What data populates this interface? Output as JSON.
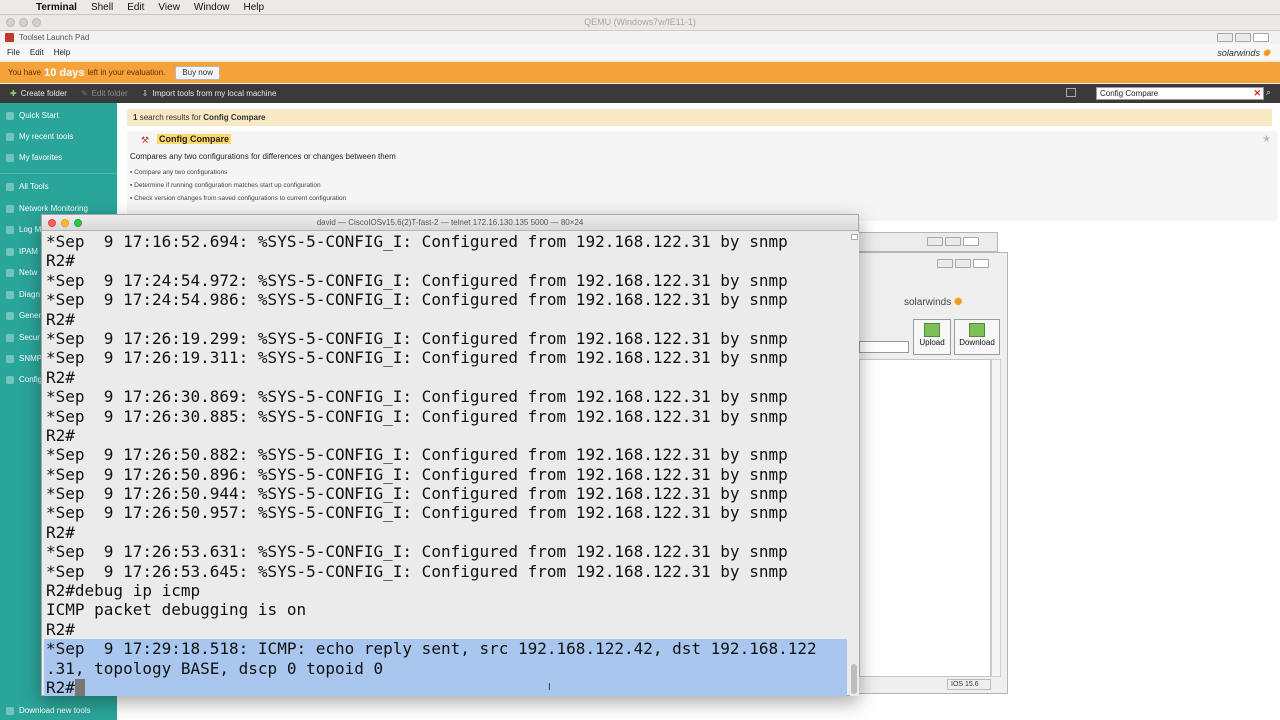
{
  "mac_menu": {
    "apple": "",
    "items": [
      "Terminal",
      "Shell",
      "Edit",
      "View",
      "Window",
      "Help"
    ]
  },
  "qemu": {
    "title": "QEMU (Windows7w/IE11-1)"
  },
  "app": {
    "title": "Toolset Launch Pad",
    "menus": [
      "File",
      "Edit",
      "Help"
    ],
    "brand": "solarwinds",
    "eval_prefix": "You have",
    "eval_days": "10 days",
    "eval_suffix": "left in your evaluation.",
    "buy_label": "Buy now",
    "toolbar": {
      "create_folder": "Create folder",
      "edit_folder": "Edit folder",
      "import_tools": "Import tools from my local machine"
    },
    "search_value": "Config Compare",
    "sidebar": [
      "Quick Start",
      "My recent tools",
      "My favorites",
      "All Tools",
      "Network Monitoring",
      "Log M",
      "IPAM",
      "Netw",
      "Diagn",
      "Gener",
      "Secur",
      "SNMP",
      "Config"
    ],
    "download_tools": "Download new tools",
    "results": {
      "count": "1",
      "text": "search results for",
      "query": "Config Compare"
    },
    "card": {
      "title": "Config Compare",
      "description": "Compares any two configurations for differences or changes between them",
      "features": [
        "Compare any two configurations",
        "Determine if running configuration matches start up configuration",
        "Check version changes from saved configurations to current configuration"
      ]
    },
    "child_window": {
      "upload": "Upload",
      "download": "Download",
      "status": "IOS  15.6"
    }
  },
  "terminal": {
    "title": "david — CiscoIOSv15.6(2)T-fast-2 — telnet 172.16.130.135 5000 — 80×24",
    "lines": [
      "*Sep  9 17:16:52.694: %SYS-5-CONFIG_I: Configured from 192.168.122.31 by snmp",
      "R2#",
      "*Sep  9 17:24:54.972: %SYS-5-CONFIG_I: Configured from 192.168.122.31 by snmp",
      "*Sep  9 17:24:54.986: %SYS-5-CONFIG_I: Configured from 192.168.122.31 by snmp",
      "R2#",
      "*Sep  9 17:26:19.299: %SYS-5-CONFIG_I: Configured from 192.168.122.31 by snmp",
      "*Sep  9 17:26:19.311: %SYS-5-CONFIG_I: Configured from 192.168.122.31 by snmp",
      "R2#",
      "*Sep  9 17:26:30.869: %SYS-5-CONFIG_I: Configured from 192.168.122.31 by snmp",
      "*Sep  9 17:26:30.885: %SYS-5-CONFIG_I: Configured from 192.168.122.31 by snmp",
      "R2#",
      "*Sep  9 17:26:50.882: %SYS-5-CONFIG_I: Configured from 192.168.122.31 by snmp",
      "*Sep  9 17:26:50.896: %SYS-5-CONFIG_I: Configured from 192.168.122.31 by snmp",
      "*Sep  9 17:26:50.944: %SYS-5-CONFIG_I: Configured from 192.168.122.31 by snmp",
      "*Sep  9 17:26:50.957: %SYS-5-CONFIG_I: Configured from 192.168.122.31 by snmp",
      "R2#",
      "*Sep  9 17:26:53.631: %SYS-5-CONFIG_I: Configured from 192.168.122.31 by snmp",
      "*Sep  9 17:26:53.645: %SYS-5-CONFIG_I: Configured from 192.168.122.31 by snmp",
      "R2#debug ip icmp",
      "ICMP packet debugging is on",
      "R2#",
      "*Sep  9 17:29:18.518: ICMP: echo reply sent, src 192.168.122.42, dst 192.168.122",
      ".31, topology BASE, dscp 0 topoid 0",
      "R2#"
    ],
    "selected_from": 21
  },
  "colors": {
    "sidebar": "#2aa59a",
    "eval_bar": "#f6a23a",
    "selection": "#a9c7ee",
    "solarwinds_orange": "#f39a1c"
  }
}
